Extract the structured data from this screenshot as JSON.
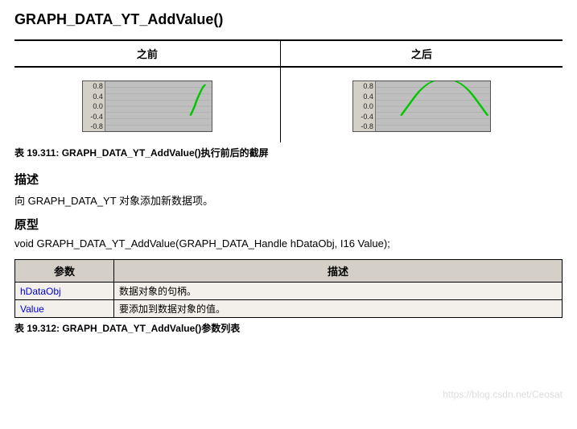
{
  "title": "GRAPH_DATA_YT_AddValue()",
  "comparison": {
    "before_label": "之前",
    "after_label": "之后",
    "yticks": [
      "0.8",
      "0.4",
      "0.0",
      "-0.4",
      "-0.8"
    ]
  },
  "caption1": "表 19.311: GRAPH_DATA_YT_AddValue()执行前后的截屏",
  "desc_heading": "描述",
  "desc_text": "向 GRAPH_DATA_YT 对象添加新数据项。",
  "proto_heading": "原型",
  "proto_text": "void GRAPH_DATA_YT_AddValue(GRAPH_DATA_Handle hDataObj, I16 Value);",
  "param_headers": {
    "name": "参数",
    "desc": "描述"
  },
  "params": [
    {
      "name": "hDataObj",
      "desc": "数据对象的句柄。"
    },
    {
      "name": "Value",
      "desc": "要添加到数据对象的值。"
    }
  ],
  "caption2": "表 19.312: GRAPH_DATA_YT_AddValue()参数列表",
  "watermark": "https://blog.csdn.net/Ceosat",
  "chart_data": [
    {
      "type": "line",
      "title": "之前",
      "ylim": [
        -0.8,
        0.8
      ],
      "xlim": [
        0,
        100
      ],
      "series": [
        {
          "name": "trace",
          "points": [
            [
              80,
              -0.3
            ],
            [
              82,
              -0.15
            ],
            [
              84,
              0.0
            ],
            [
              86,
              0.2
            ],
            [
              88,
              0.35
            ],
            [
              90,
              0.5
            ],
            [
              92,
              0.62
            ],
            [
              94,
              0.7
            ]
          ]
        }
      ]
    },
    {
      "type": "line",
      "title": "之后",
      "ylim": [
        -0.8,
        0.8
      ],
      "xlim": [
        0,
        100
      ],
      "series": [
        {
          "name": "trace",
          "points": [
            [
              22,
              -0.3
            ],
            [
              26,
              -0.1
            ],
            [
              30,
              0.1
            ],
            [
              34,
              0.3
            ],
            [
              38,
              0.48
            ],
            [
              42,
              0.62
            ],
            [
              46,
              0.73
            ],
            [
              50,
              0.8
            ],
            [
              54,
              0.84
            ],
            [
              58,
              0.86
            ],
            [
              62,
              0.86
            ],
            [
              66,
              0.84
            ],
            [
              70,
              0.8
            ],
            [
              74,
              0.73
            ],
            [
              78,
              0.62
            ],
            [
              82,
              0.48
            ],
            [
              86,
              0.3
            ],
            [
              90,
              0.1
            ],
            [
              94,
              -0.1
            ],
            [
              98,
              -0.3
            ]
          ]
        }
      ]
    }
  ]
}
